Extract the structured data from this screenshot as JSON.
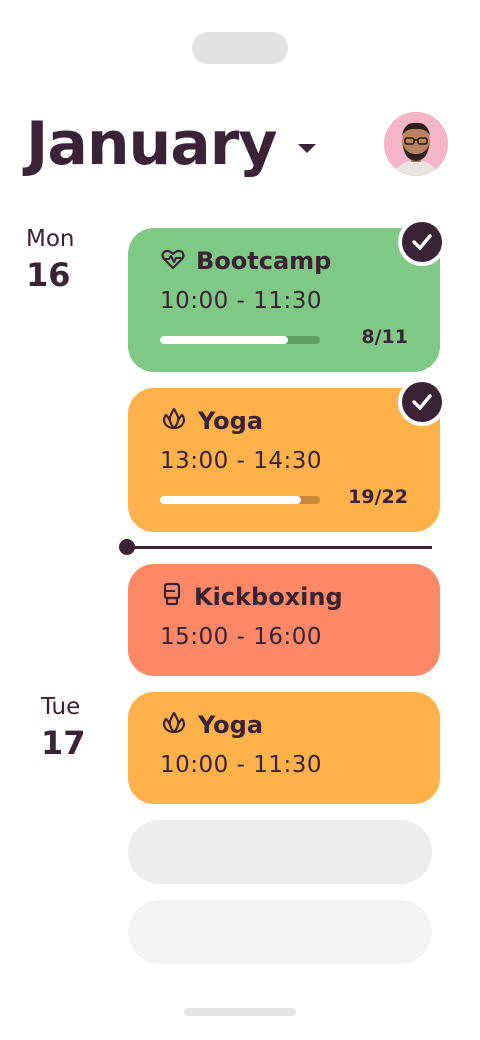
{
  "header": {
    "month": "January"
  },
  "colors": {
    "green": "#80c885",
    "orange": "#ffb24b",
    "red": "#ff8966",
    "text": "#3a2335"
  },
  "days": [
    {
      "dow": "Mon",
      "num": "16",
      "events": [
        {
          "title": "Bootcamp",
          "icon": "heart-pulse-icon",
          "time": "10:00 - 11:30",
          "count": "8/11",
          "progress": 0.8,
          "done": true
        },
        {
          "title": "Yoga",
          "icon": "lotus-icon",
          "time": "13:00 - 14:30",
          "count": "19/22",
          "progress": 0.88,
          "done": true
        },
        {
          "title": "Kickboxing",
          "icon": "boxing-glove-icon",
          "time": "15:00 - 16:00"
        }
      ]
    },
    {
      "dow": "Tue",
      "num": "17",
      "events": [
        {
          "title": "Yoga",
          "icon": "lotus-icon",
          "time": "10:00 - 11:30"
        }
      ]
    }
  ]
}
